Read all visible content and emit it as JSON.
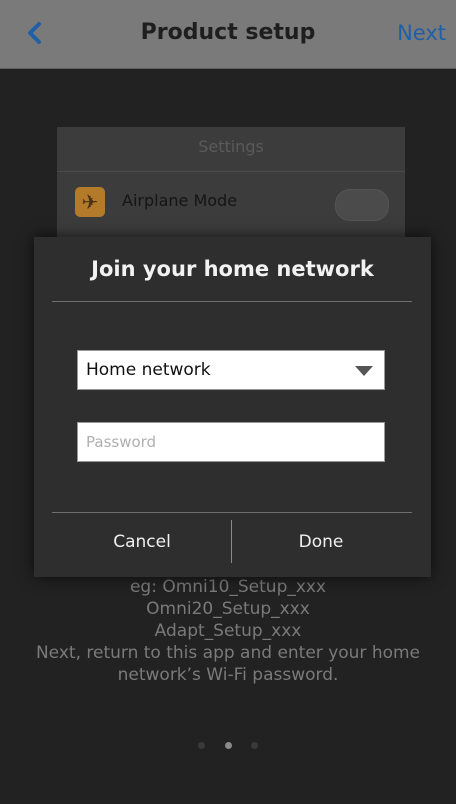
{
  "navbar": {
    "back_icon": "chevron-left-icon",
    "title": "Product setup",
    "next_label": "Next"
  },
  "background": {
    "settings_title": "Settings",
    "airplane_icon": "airplane-icon",
    "airplane_label": "Airplane Mode",
    "instructions": [
      "eg: Omni10_Setup_xxx",
      "Omni20_Setup_xxx",
      "Adapt_Setup_xxx",
      "Next, return to this app and enter your home",
      "network’s Wi-Fi password."
    ],
    "page_indicator": {
      "total": 3,
      "active": 2
    }
  },
  "dialog": {
    "title": "Join your home network",
    "network_select": {
      "value": "Home network",
      "icon": "dropdown-arrow-icon"
    },
    "password": {
      "placeholder": "Password",
      "value": ""
    },
    "cancel_label": "Cancel",
    "done_label": "Done"
  },
  "colors": {
    "accent": "#1f5fa8",
    "navbar_bg": "#7a7a7a",
    "dialog_bg": "#2e2e2e"
  }
}
